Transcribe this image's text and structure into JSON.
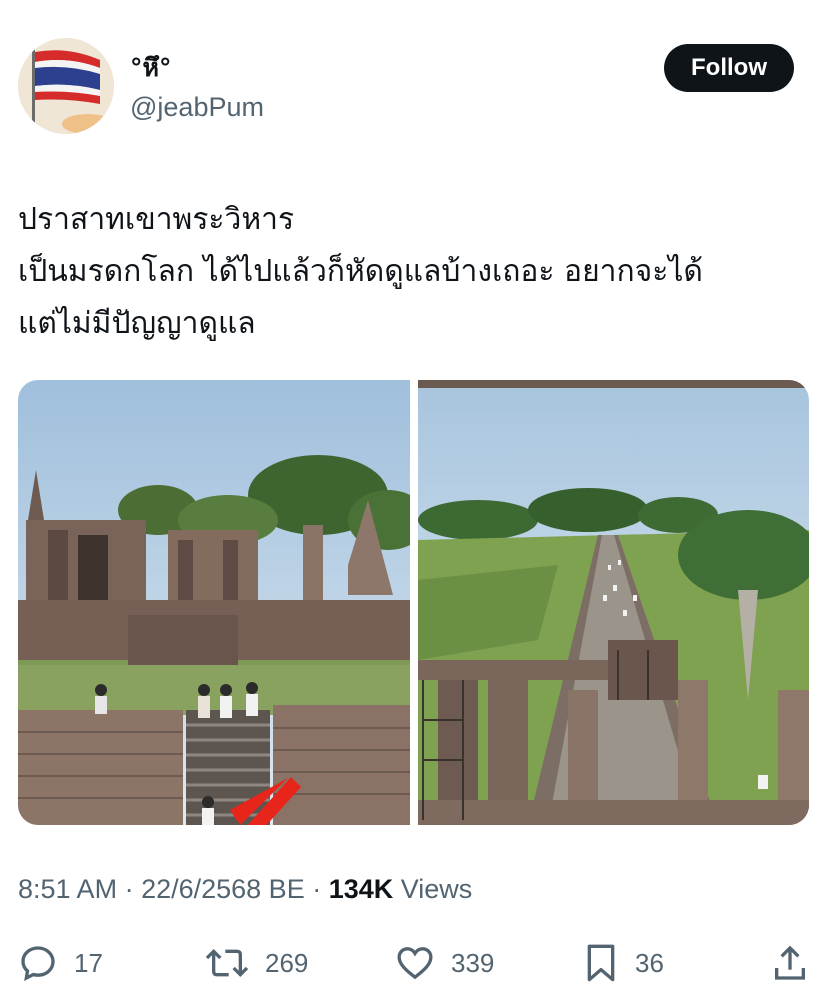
{
  "user": {
    "display_name": "°หึ°",
    "handle": "@jeabPum",
    "avatar_icon": "thai-flag-avatar"
  },
  "follow_label": "Follow",
  "tweet_lines": [
    "ปราสาทเขาพระวิหาร",
    "เป็นมรดกโลก ได้ไปแล้วก็หัดดูแลบ้างเถอะ อยากจะได้",
    "แต่ไม่มีปัญญาดูแล"
  ],
  "media": [
    {
      "icon": "temple-ruins-photo"
    },
    {
      "icon": "temple-causeway-photo"
    }
  ],
  "meta": {
    "time": "8:51 AM",
    "sep1": " · ",
    "date": "22/6/2568 BE",
    "sep2": " · ",
    "views_count": "134K",
    "views_label": " Views"
  },
  "actions": {
    "replies": "17",
    "reposts": "269",
    "likes": "339",
    "bookmarks": "36"
  },
  "colors": {
    "text": "#0f1419",
    "secondary": "#536471",
    "arrow": "#e8251b"
  }
}
